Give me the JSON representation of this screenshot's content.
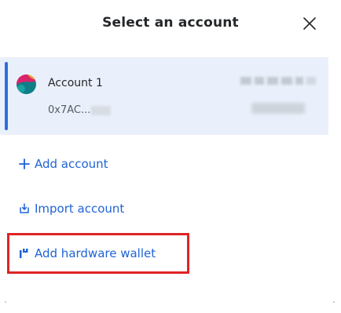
{
  "header": {
    "title": "Select an account",
    "close_icon": "close-icon"
  },
  "account": {
    "name": "Account 1",
    "address_prefix": "0x7AC...",
    "selected": true,
    "avatar_icon": "jazzicon-avatar"
  },
  "actions": {
    "add_account": {
      "label": "Add account",
      "icon": "plus-icon"
    },
    "import_account": {
      "label": "Import account",
      "icon": "import-icon"
    },
    "add_hardware_wallet": {
      "label": "Add hardware wallet",
      "icon": "hardware-wallet-icon",
      "highlighted": true
    }
  },
  "colors": {
    "accent": "#2f6ddb",
    "link": "#1f63d6",
    "selected_bg": "#eaf0fb",
    "highlight": "#e02424"
  }
}
